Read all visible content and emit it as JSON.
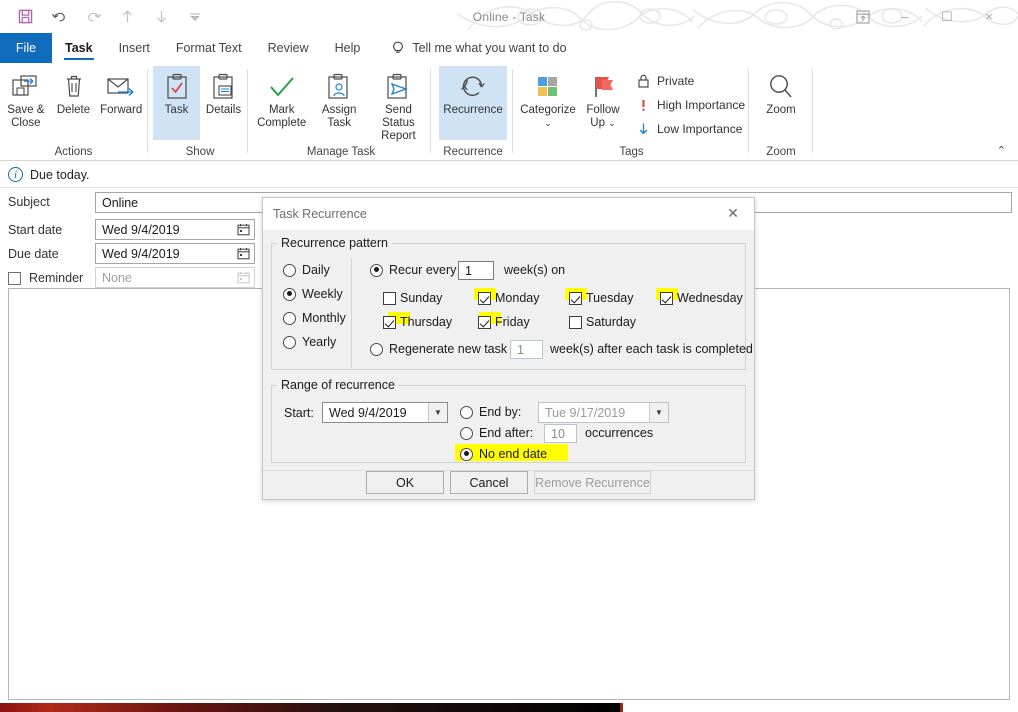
{
  "window": {
    "title": "Online  -  Task",
    "quick_access": [
      {
        "name": "save-icon",
        "label": "Save"
      },
      {
        "name": "undo-icon",
        "label": "Undo"
      },
      {
        "name": "redo-icon",
        "label": "Redo"
      },
      {
        "name": "previous-item-icon",
        "label": "Previous Item"
      },
      {
        "name": "next-item-icon",
        "label": "Next Item"
      },
      {
        "name": "customize-quick-access-toolbar-icon",
        "label": "Customize Quick Access Toolbar"
      }
    ],
    "controls": {
      "ribbon_display_options": "Ribbon Display Options",
      "minimize": "–",
      "maximize": "☐",
      "close": "×"
    }
  },
  "tabs": {
    "file": "File",
    "items": [
      {
        "label": "Task",
        "active": true
      },
      {
        "label": "Insert",
        "active": false
      },
      {
        "label": "Format Text",
        "active": false
      },
      {
        "label": "Review",
        "active": false
      },
      {
        "label": "Help",
        "active": false
      }
    ],
    "tell_me": "Tell me what you want to do"
  },
  "ribbon": {
    "groups": [
      {
        "name": "actions",
        "label": "Actions",
        "buttons": [
          {
            "label": "Save &\nClose",
            "icon": "save-and-close-icon",
            "selected": false
          },
          {
            "label": "Delete",
            "icon": "delete-icon",
            "selected": false
          },
          {
            "label": "Forward",
            "icon": "forward-icon",
            "selected": false
          }
        ]
      },
      {
        "name": "show",
        "label": "Show",
        "buttons": [
          {
            "label": "Task",
            "icon": "task-icon",
            "selected": true
          },
          {
            "label": "Details",
            "icon": "details-icon",
            "selected": false
          }
        ]
      },
      {
        "name": "manage-task",
        "label": "Manage Task",
        "buttons": [
          {
            "label": "Mark\nComplete",
            "icon": "mark-complete-icon",
            "selected": false
          },
          {
            "label": "Assign\nTask",
            "icon": "assign-task-icon",
            "selected": false
          },
          {
            "label": "Send Status\nReport",
            "icon": "send-status-report-icon",
            "selected": false
          }
        ]
      },
      {
        "name": "recurrence",
        "label": "Recurrence",
        "buttons": [
          {
            "label": "Recurrence",
            "icon": "recurrence-icon",
            "selected": true
          }
        ]
      },
      {
        "name": "tags",
        "label": "Tags",
        "buttons": [
          {
            "label": "Categorize",
            "icon": "categorize-icon",
            "selected": false
          },
          {
            "label": "Follow\nUp",
            "icon": "follow-up-icon",
            "selected": false
          }
        ],
        "small_buttons": [
          {
            "label": "Private",
            "icon": "lock-icon"
          },
          {
            "label": "High Importance",
            "icon": "high-importance-icon"
          },
          {
            "label": "Low Importance",
            "icon": "low-importance-icon"
          }
        ]
      },
      {
        "name": "zoom",
        "label": "Zoom",
        "buttons": [
          {
            "label": "Zoom",
            "icon": "zoom-icon",
            "selected": false
          }
        ]
      }
    ],
    "collapse_label": "⌃"
  },
  "form": {
    "info_bar": "Due today.",
    "fields": [
      {
        "label": "Subject",
        "value": "Online",
        "disabled": false,
        "has_calendar": false
      },
      {
        "label": "Start date",
        "value": "Wed 9/4/2019",
        "disabled": false,
        "has_calendar": true
      },
      {
        "label": "Due date",
        "value": "Wed 9/4/2019",
        "disabled": false,
        "has_calendar": true
      }
    ],
    "reminder": {
      "label": "Reminder",
      "checked": false,
      "value": "None",
      "disabled": true
    }
  },
  "dialog": {
    "title": "Task Recurrence",
    "close_glyph": "✕",
    "pattern": {
      "legend": "Recurrence pattern",
      "frequencies": [
        {
          "label": "Daily",
          "selected": false
        },
        {
          "label": "Weekly",
          "selected": true
        },
        {
          "label": "Monthly",
          "selected": false
        },
        {
          "label": "Yearly",
          "selected": false
        }
      ],
      "recur_every": {
        "label": "Recur every",
        "selected": true,
        "value": "1",
        "suffix": "week(s) on"
      },
      "days": [
        {
          "label": "Sunday",
          "checked": false,
          "highlighted": false
        },
        {
          "label": "Monday",
          "checked": true,
          "highlighted": true
        },
        {
          "label": "Tuesday",
          "checked": true,
          "highlighted": true
        },
        {
          "label": "Wednesday",
          "checked": true,
          "highlighted": true
        },
        {
          "label": "Thursday",
          "checked": true,
          "highlighted": true
        },
        {
          "label": "Friday",
          "checked": true,
          "highlighted": true
        },
        {
          "label": "Saturday",
          "checked": false,
          "highlighted": false
        }
      ],
      "regenerate": {
        "label": "Regenerate new task",
        "selected": false,
        "value": "1",
        "suffix": "week(s) after each task is completed"
      }
    },
    "range": {
      "legend": "Range of recurrence",
      "start_label": "Start:",
      "start_value": "Wed 9/4/2019",
      "end_by": {
        "label": "End by:",
        "selected": false,
        "value": "Tue 9/17/2019"
      },
      "end_after": {
        "label": "End after:",
        "selected": false,
        "value": "10",
        "suffix": "occurrences"
      },
      "no_end_date": {
        "label": "No end date",
        "selected": true,
        "highlighted": true
      }
    },
    "buttons": [
      {
        "label": "OK",
        "disabled": false
      },
      {
        "label": "Cancel",
        "disabled": false
      },
      {
        "label": "Remove Recurrence",
        "disabled": true
      }
    ]
  },
  "colors": {
    "accent": "#0f6cbd",
    "highlight": "#ffff00",
    "file_tab": "#0f6cbd",
    "selected_ribbon": "#cfe3f5"
  }
}
